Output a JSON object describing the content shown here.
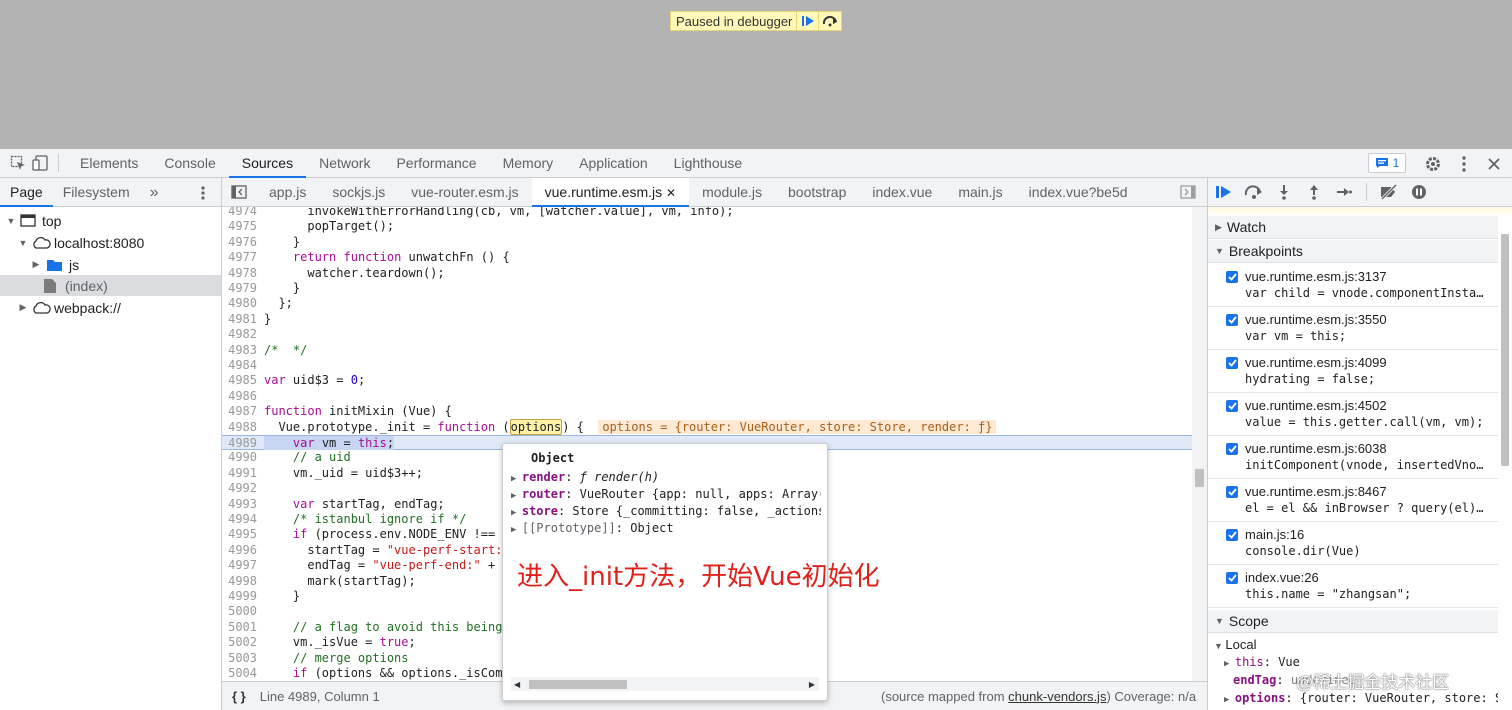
{
  "paused_banner": {
    "text": "Paused in debugger"
  },
  "devtools_tabs": [
    "Elements",
    "Console",
    "Sources",
    "Network",
    "Performance",
    "Memory",
    "Application",
    "Lighthouse"
  ],
  "active_tab": "Sources",
  "issues_count": "1",
  "navigator": {
    "tabs": [
      "Page",
      "Filesystem"
    ],
    "more": "»",
    "tree": [
      {
        "label": "top"
      },
      {
        "label": "localhost:8080"
      },
      {
        "label": "js"
      },
      {
        "label": "(index)"
      },
      {
        "label": "webpack://"
      }
    ]
  },
  "file_tabs": [
    "app.js",
    "sockjs.js",
    "vue-router.esm.js",
    "vue.runtime.esm.js",
    "module.js",
    "bootstrap",
    "index.vue",
    "main.js",
    "index.vue?be5d"
  ],
  "code": {
    "lines": [
      {
        "n": "4974",
        "t": "      invokeWithErrorHandling(cb, vm, [watcher.value], vm, info);"
      },
      {
        "n": "4975",
        "t": "      popTarget();"
      },
      {
        "n": "4976",
        "t": "    }"
      },
      {
        "n": "4977",
        "t": "    return function unwatchFn () {"
      },
      {
        "n": "4978",
        "t": "      watcher.teardown();"
      },
      {
        "n": "4979",
        "t": "    }"
      },
      {
        "n": "4980",
        "t": "  };"
      },
      {
        "n": "4981",
        "t": "}"
      },
      {
        "n": "4982",
        "t": ""
      },
      {
        "n": "4983",
        "t": "/*  */"
      },
      {
        "n": "4984",
        "t": ""
      },
      {
        "n": "4985",
        "t": "var uid$3 = 0;"
      },
      {
        "n": "4986",
        "t": ""
      },
      {
        "n": "4987",
        "t": "function initMixin (Vue) {"
      },
      {
        "n": "4988",
        "t": "  Vue.prototype._init = function (options) {"
      },
      {
        "n": "4989",
        "t": "    var vm = this;"
      },
      {
        "n": "4990",
        "t": "    // a uid"
      },
      {
        "n": "4991",
        "t": "    vm._uid = uid$3++;"
      },
      {
        "n": "4992",
        "t": ""
      },
      {
        "n": "4993",
        "t": "    var startTag, endTag;"
      },
      {
        "n": "4994",
        "t": "    /* istanbul ignore if */"
      },
      {
        "n": "4995",
        "t": "    if (process.env.NODE_ENV !=="
      },
      {
        "n": "4996",
        "t": "      startTag = \"vue-perf-start:"
      },
      {
        "n": "4997",
        "t": "      endTag = \"vue-perf-end:\" +"
      },
      {
        "n": "4998",
        "t": "      mark(startTag);"
      },
      {
        "n": "4999",
        "t": "    }"
      },
      {
        "n": "5000",
        "t": ""
      },
      {
        "n": "5001",
        "t": "    // a flag to avoid this being"
      },
      {
        "n": "5002",
        "t": "    vm._isVue = true;"
      },
      {
        "n": "5003",
        "t": "    // merge options"
      },
      {
        "n": "5004",
        "t": "    if (options && options._isCom"
      }
    ],
    "inline_value": "options = {router: VueRouter, store: Store, render: ƒ}"
  },
  "popover": {
    "title": "Object",
    "props": [
      {
        "key": "render",
        "sep": ": ",
        "val": "ƒ render(h)"
      },
      {
        "key": "router",
        "sep": ": ",
        "val": "VueRouter {app: null, apps: Array("
      },
      {
        "key": "store",
        "sep": ": ",
        "val": "Store {_committing: false, _actions"
      },
      {
        "key": "[[Prototype]]",
        "sep": ": ",
        "val": "Object"
      }
    ],
    "annotation": "进入_init方法，开始Vue初始化"
  },
  "status": {
    "position": "Line 4989, Column 1",
    "source_prefix": "(source mapped from ",
    "source_link": "chunk-vendors.js",
    "source_suffix": ")",
    "coverage": "Coverage: n/a"
  },
  "right_panel": {
    "watch_label": "Watch",
    "breakpoints_label": "Breakpoints",
    "breakpoints": [
      {
        "loc": "vue.runtime.esm.js:3137",
        "src": "var child = vnode.componentInsta…"
      },
      {
        "loc": "vue.runtime.esm.js:3550",
        "src": "var vm = this;"
      },
      {
        "loc": "vue.runtime.esm.js:4099",
        "src": "hydrating = false;"
      },
      {
        "loc": "vue.runtime.esm.js:4502",
        "src": "value = this.getter.call(vm, vm);"
      },
      {
        "loc": "vue.runtime.esm.js:6038",
        "src": "initComponent(vnode, insertedVno…"
      },
      {
        "loc": "vue.runtime.esm.js:8467",
        "src": "el = el && inBrowser ? query(el)…"
      },
      {
        "loc": "main.js:16",
        "src": "console.dir(Vue)"
      },
      {
        "loc": "index.vue:26",
        "src": "this.name = \"zhangsan\";"
      }
    ],
    "scope_label": "Scope",
    "local_label": "Local",
    "scope_vars": [
      {
        "key": "this",
        "val": "Vue"
      },
      {
        "key": "endTag",
        "val": "undefined"
      },
      {
        "key": "options",
        "val": "{router: VueRouter, store: S"
      }
    ]
  },
  "watermark": "@稀土掘金技术社区",
  "colors": {
    "accent": "#1a73e8",
    "annotation": "#e0211b",
    "paused_bg": "#fff8b8"
  }
}
